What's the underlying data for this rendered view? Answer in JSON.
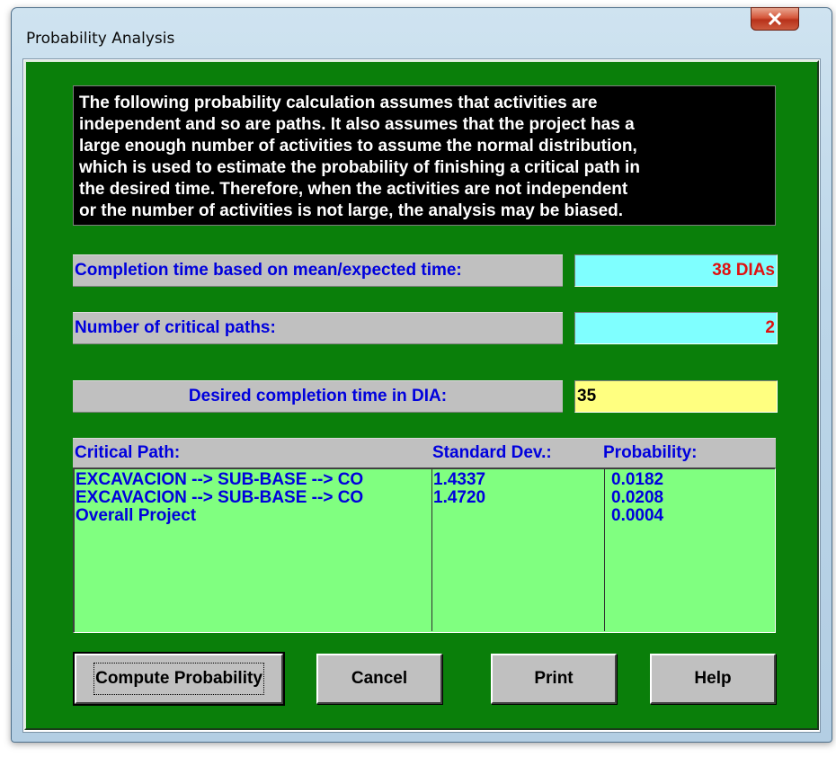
{
  "window": {
    "title": "Probability Analysis",
    "close_glyph": "X"
  },
  "notice": {
    "lines": [
      "The following probability calculation assumes that activities are",
      "independent and so are paths. It also assumes that the project has a",
      "large enough number of activities to assume the normal distribution,",
      "which is used to estimate the probability of finishing a critical path in",
      "the desired time.  Therefore, when the activities are not independent",
      "or the number of activities is not large, the analysis may be biased."
    ]
  },
  "completion": {
    "label": "Completion time based on mean/expected time:",
    "value": "38 DIAs"
  },
  "critical_paths": {
    "label": "Number of critical paths:",
    "value": "2"
  },
  "desired": {
    "label": "Desired completion time in DIA:",
    "value": "35"
  },
  "table": {
    "headers": [
      "Critical Path:",
      "Standard Dev.:",
      "Probability:"
    ],
    "rows": [
      {
        "path": "EXCAVACION --> SUB-BASE --> CO",
        "std": "1.4337",
        "prob": "0.0182"
      },
      {
        "path": "EXCAVACION --> SUB-BASE --> CO",
        "std": "1.4720",
        "prob": "0.0208"
      },
      {
        "path": "Overall Project",
        "std": "",
        "prob": "0.0004"
      }
    ]
  },
  "buttons": {
    "compute": "Compute Probability",
    "cancel": "Cancel",
    "print": "Print",
    "help": "Help"
  },
  "colors": {
    "panel_bg": "#0a7f0a",
    "label_text": "#0000dd",
    "value_red": "#e01010",
    "cyan_box": "#7fffff",
    "yellow_box": "#ffff80",
    "grid_bg": "#80ff80"
  }
}
